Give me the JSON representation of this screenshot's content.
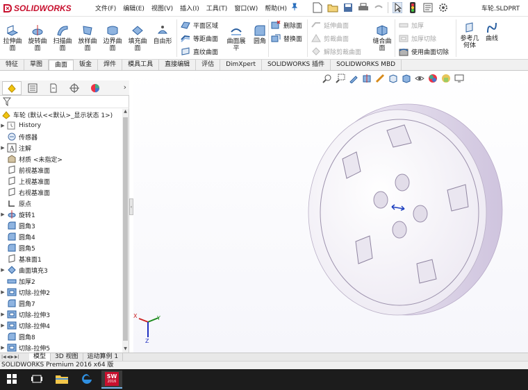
{
  "app": {
    "brand": "SOLIDWORKS",
    "document_title": "车轮.SLDPRT"
  },
  "menus": [
    "文件(F)",
    "编辑(E)",
    "视图(V)",
    "插入(I)",
    "工具(T)",
    "窗口(W)",
    "帮助(H)"
  ],
  "ribbon": {
    "large_tools": [
      {
        "label": "拉伸曲面",
        "icon": "extruded-surface-icon"
      },
      {
        "label": "旋转曲面",
        "icon": "revolved-surface-icon"
      },
      {
        "label": "扫描曲面",
        "icon": "swept-surface-icon"
      },
      {
        "label": "放样曲面",
        "icon": "lofted-surface-icon"
      },
      {
        "label": "边界曲面",
        "icon": "boundary-surface-icon"
      },
      {
        "label": "填充曲面",
        "icon": "filled-surface-icon"
      },
      {
        "label": "自由形",
        "icon": "freeform-icon"
      }
    ],
    "group2": [
      {
        "label": "平面区域",
        "icon": "planar-surface-icon"
      },
      {
        "label": "等距曲面",
        "icon": "offset-surface-icon"
      },
      {
        "label": "直纹曲面",
        "icon": "ruled-surface-icon"
      }
    ],
    "flatten": {
      "label": "曲面展平"
    },
    "fillet": {
      "label": "圆角"
    },
    "group3": [
      {
        "label": "删除面",
        "enabled": true
      },
      {
        "label": "替换面",
        "enabled": true
      }
    ],
    "group4": [
      {
        "label": "延伸曲面",
        "enabled": false
      },
      {
        "label": "剪裁曲面",
        "enabled": false
      },
      {
        "label": "解除剪裁曲面",
        "enabled": false
      }
    ],
    "knit": {
      "label": "缝合曲面"
    },
    "group5": [
      {
        "label": "加厚",
        "enabled": false
      },
      {
        "label": "加厚切除",
        "enabled": false
      },
      {
        "label": "使用曲面切除",
        "enabled": true
      }
    ],
    "ref_geometry": {
      "label": "参考几何体"
    },
    "curves": {
      "label": "曲线"
    }
  },
  "tabs": [
    "特征",
    "草图",
    "曲面",
    "钣金",
    "焊件",
    "模具工具",
    "直接编辑",
    "评估",
    "DimXpert",
    "SOLIDWORKS 插件",
    "SOLIDWORKS MBD"
  ],
  "active_tab": "曲面",
  "tree": {
    "root": "车轮  (默认<<默认>_显示状态 1>)",
    "items": [
      {
        "label": "History",
        "icon": "history-icon",
        "expandable": true
      },
      {
        "label": "传感器",
        "icon": "sensor-icon",
        "expandable": false
      },
      {
        "label": "注解",
        "icon": "annotation-icon",
        "expandable": true
      },
      {
        "label": "材质 <未指定>",
        "icon": "material-icon",
        "expandable": false
      },
      {
        "label": "前视基准面",
        "icon": "plane-icon",
        "expandable": false
      },
      {
        "label": "上视基准面",
        "icon": "plane-icon",
        "expandable": false
      },
      {
        "label": "右视基准面",
        "icon": "plane-icon",
        "expandable": false
      },
      {
        "label": "原点",
        "icon": "origin-icon",
        "expandable": false
      },
      {
        "label": "旋转1",
        "icon": "revolve-feature-icon",
        "expandable": true
      },
      {
        "label": "圆角3",
        "icon": "fillet-feature-icon",
        "expandable": false
      },
      {
        "label": "圆角4",
        "icon": "fillet-feature-icon",
        "expandable": false
      },
      {
        "label": "圆角5",
        "icon": "fillet-feature-icon",
        "expandable": false
      },
      {
        "label": "基准面1",
        "icon": "plane-icon",
        "expandable": false
      },
      {
        "label": "曲面填充3",
        "icon": "fill-surface-feature-icon",
        "expandable": true
      },
      {
        "label": "加厚2",
        "icon": "thicken-feature-icon",
        "expandable": false
      },
      {
        "label": "切除-拉伸2",
        "icon": "cut-extrude-icon",
        "expandable": true
      },
      {
        "label": "圆角7",
        "icon": "fillet-feature-icon",
        "expandable": false
      },
      {
        "label": "切除-拉伸3",
        "icon": "cut-extrude-icon",
        "expandable": true
      },
      {
        "label": "切除-拉伸4",
        "icon": "cut-extrude-icon",
        "expandable": true
      },
      {
        "label": "圆角8",
        "icon": "fillet-feature-icon",
        "expandable": false
      },
      {
        "label": "切除-拉伸5",
        "icon": "cut-extrude-icon",
        "expandable": true
      }
    ]
  },
  "bottom_tabs": [
    "模型",
    "3D 视图",
    "运动算例 1"
  ],
  "status": "SOLIDWORKS Premium 2016 x64 版",
  "taskbar": {
    "solidworks_badge": "SW",
    "solidworks_year": "2016"
  },
  "triad": {
    "x": "X",
    "y": "Y",
    "z": "Z"
  },
  "colors": {
    "brand_red": "#c8102e",
    "model_face": "#f4f2f8",
    "model_rim": "#d8d0e2",
    "accent_blue": "#2a6fbd"
  }
}
